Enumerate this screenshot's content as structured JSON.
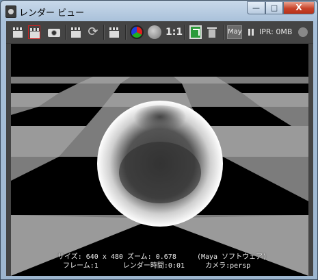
{
  "window": {
    "title": "レンダー ビュー",
    "controls": {
      "minimize": "—",
      "maximize": "□",
      "close": "X"
    }
  },
  "toolbar": {
    "icons": [
      "clapper-icon",
      "clapper-region-icon",
      "camera-snapshot-icon",
      "clapper-icon",
      "refresh-icon",
      "clapper-sequence-icon",
      "rgb-channels-icon",
      "gray-sphere-icon",
      "one-to-one-label",
      "green-frame-icon",
      "trash-icon",
      "maya-renderer-label",
      "pause-icon",
      "ipr-label",
      "status-dot-icon"
    ],
    "one_to_one": "1:1",
    "renderer_label": "Maya",
    "ipr_label": "IPR: 0MB"
  },
  "render_info": {
    "size_label": "サイズ:",
    "size_value": "640 x 480",
    "zoom_label": "ズーム:",
    "zoom_value": "0.678",
    "renderer": "(Maya ソフトウェア)",
    "frame_label": "フレーム:",
    "frame_value": "1",
    "render_time_label": "レンダー時間:",
    "render_time_value": "0:01",
    "camera_label": "カメラ:",
    "camera_value": "persp"
  },
  "colors": {
    "titlebar": "#a9c1da",
    "close_button": "#c7432a",
    "toolbar_bg": "#444444",
    "checker_light": "#9a9a9a",
    "checker_dark": "#000000"
  }
}
